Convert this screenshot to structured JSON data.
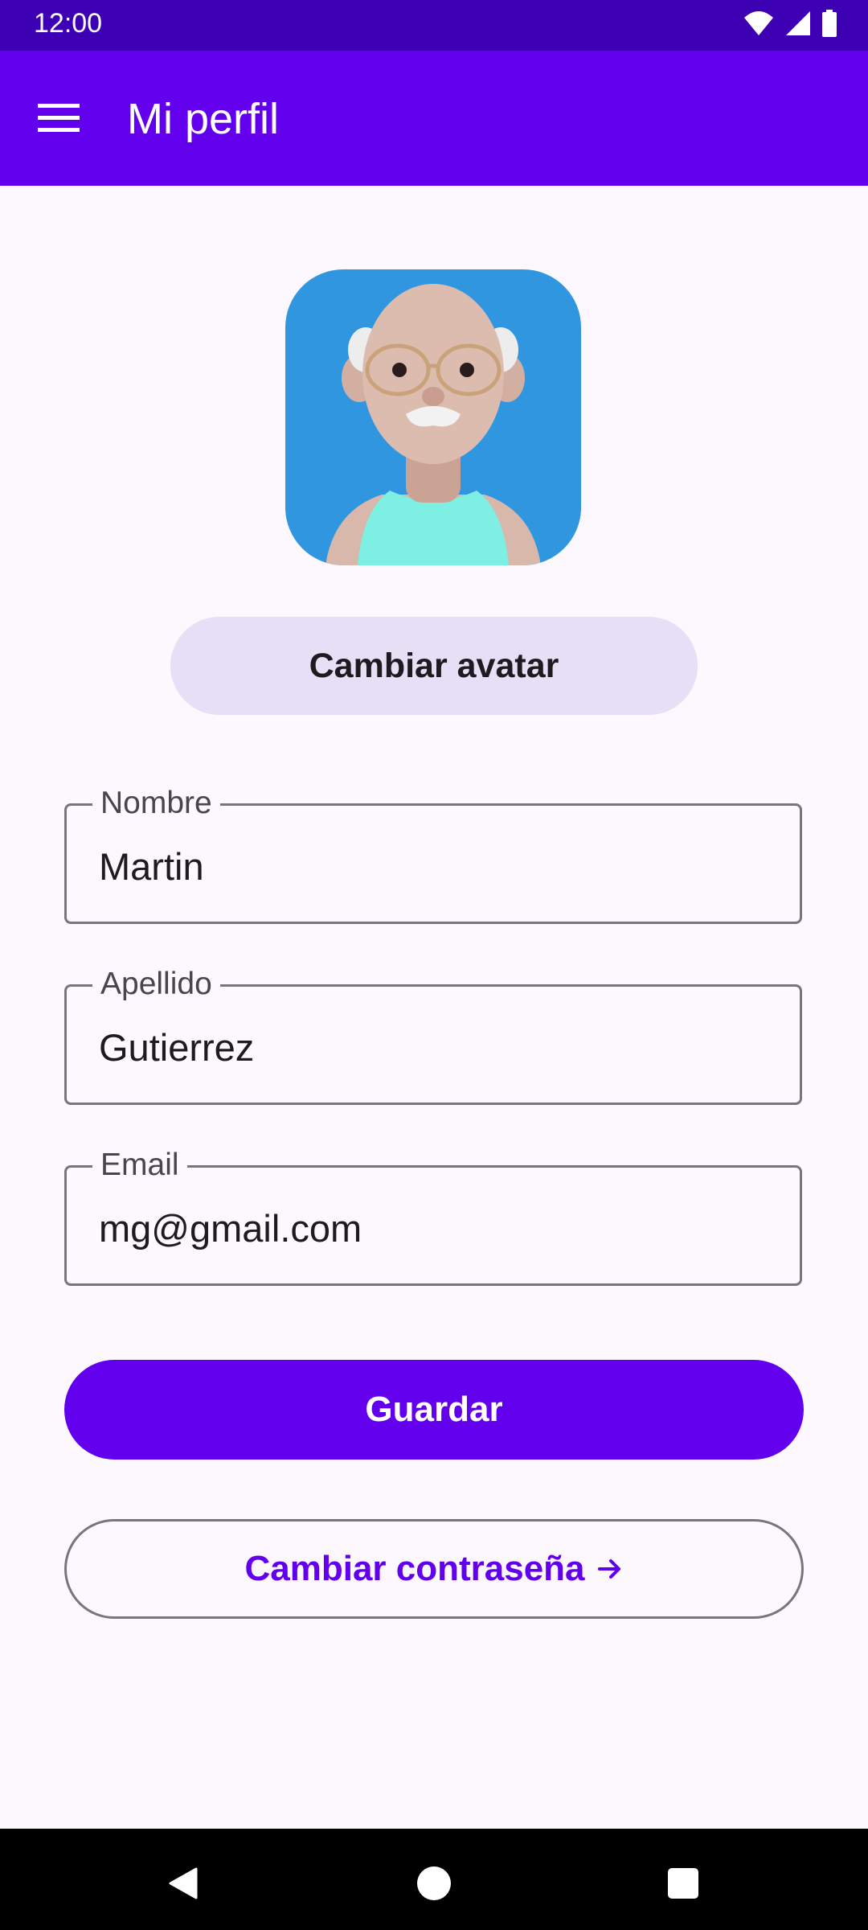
{
  "status_bar": {
    "time": "12:00",
    "icons": [
      "wifi-icon",
      "signal-icon",
      "battery-icon"
    ]
  },
  "app_bar": {
    "title": "Mi perfil",
    "menu_icon": "menu-icon"
  },
  "profile": {
    "change_avatar_label": "Cambiar avatar",
    "fields": {
      "first_name": {
        "label": "Nombre",
        "value": "Martin"
      },
      "last_name": {
        "label": "Apellido",
        "value": "Gutierrez"
      },
      "email": {
        "label": "Email",
        "value": "mg@gmail.com"
      }
    },
    "save_label": "Guardar",
    "change_password_label": "Cambiar contraseña"
  },
  "colors": {
    "primary": "#6200EE",
    "status_bar": "#3E00B3",
    "background": "#FDF7FE",
    "tonal": "#E6DFF5",
    "avatar_bg": "#2F96DF"
  },
  "nav": {
    "icons": [
      "back-icon",
      "home-icon",
      "recents-icon"
    ]
  }
}
